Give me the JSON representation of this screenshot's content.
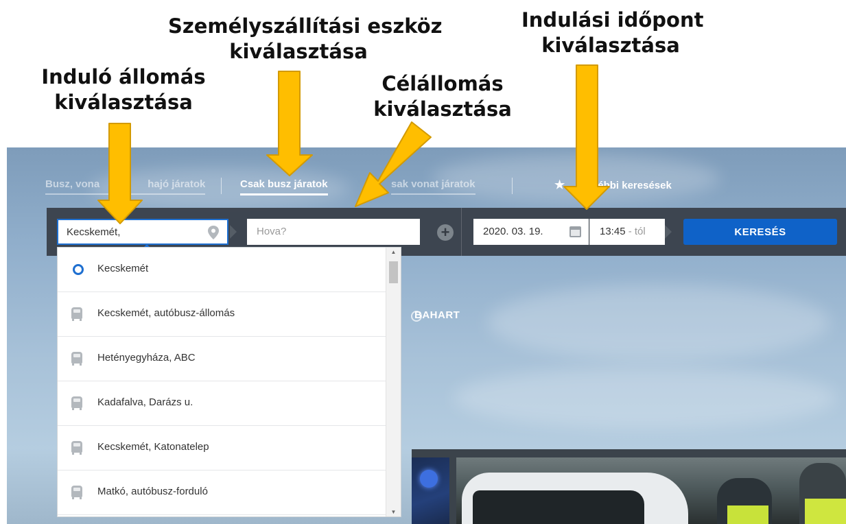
{
  "annotations": {
    "origin": [
      "Induló állomás",
      "kiválasztása"
    ],
    "transport_mode": [
      "Személyszállítási eszköz",
      "kiválasztása"
    ],
    "destination": [
      "Célállomás",
      "kiválasztása"
    ],
    "departure_time": [
      "Indulási időpont",
      "kiválasztása"
    ]
  },
  "tabs": [
    {
      "label": "Busz, vonat és hajó járatok",
      "visible_text": "Busz, vona",
      "active": false
    },
    {
      "label": "Csak busz járatok",
      "active": true
    },
    {
      "label": "Csak vonat járatok",
      "visible_text": "sak vonat járatok",
      "active": false
    },
    {
      "label": "További keresések",
      "visible_text": "ébbi keresések",
      "icon": "star-icon",
      "active": false
    }
  ],
  "search": {
    "origin_value": "Kecskemét,",
    "destination_placeholder": "Hova?",
    "date": "2020. 03. 19.",
    "time": "13:45",
    "time_suffix": " - tól",
    "button_label": "KERESÉS",
    "add_icon": "plus-circle-icon"
  },
  "dropdown": {
    "items": [
      {
        "label": "Kecskemét",
        "icon": "location-ring-icon"
      },
      {
        "label": "Kecskemét, autóbusz-állomás",
        "icon": "bus-icon"
      },
      {
        "label": "Hetényegyháza, ABC",
        "icon": "bus-icon"
      },
      {
        "label": "Kadafalva, Darázs u.",
        "icon": "bus-icon"
      },
      {
        "label": "Kecskemét, Katonatelep",
        "icon": "bus-icon"
      },
      {
        "label": "Matkó, autóbusz-forduló",
        "icon": "bus-icon"
      }
    ]
  },
  "background": {
    "partner_label": "BAHART"
  },
  "colors": {
    "accent_blue": "#0f62c8",
    "arrow_yellow": "#ffbe00",
    "panel_dark": "#343a42"
  }
}
